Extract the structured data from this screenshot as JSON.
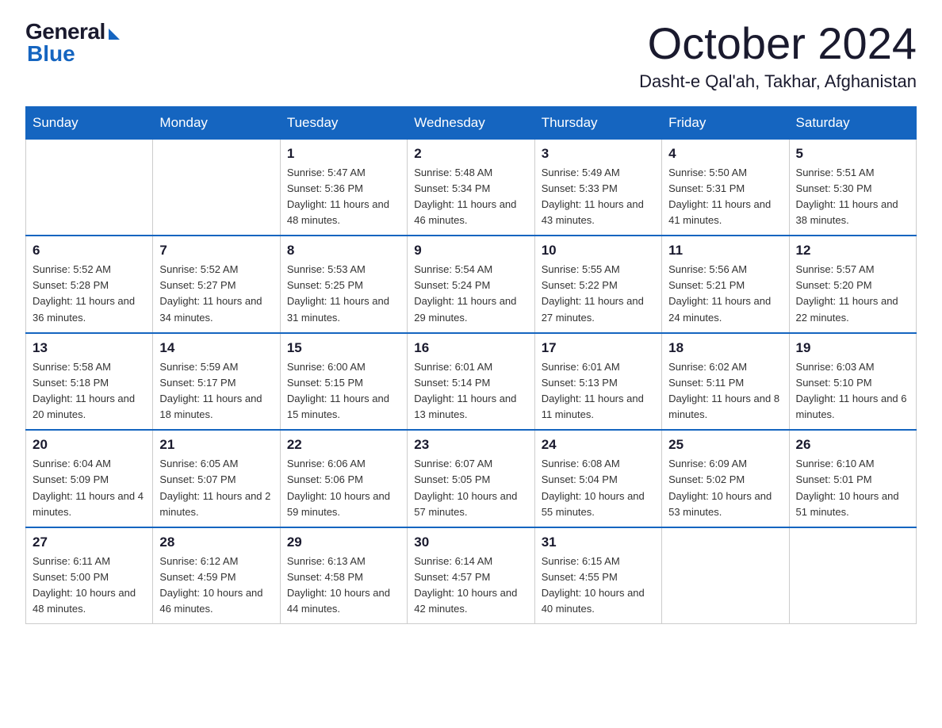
{
  "header": {
    "logo_general": "General",
    "logo_blue": "Blue",
    "month_title": "October 2024",
    "location": "Dasht-e Qal'ah, Takhar, Afghanistan"
  },
  "weekdays": [
    "Sunday",
    "Monday",
    "Tuesday",
    "Wednesday",
    "Thursday",
    "Friday",
    "Saturday"
  ],
  "weeks": [
    [
      {
        "day": "",
        "info": ""
      },
      {
        "day": "",
        "info": ""
      },
      {
        "day": "1",
        "info": "Sunrise: 5:47 AM\nSunset: 5:36 PM\nDaylight: 11 hours\nand 48 minutes."
      },
      {
        "day": "2",
        "info": "Sunrise: 5:48 AM\nSunset: 5:34 PM\nDaylight: 11 hours\nand 46 minutes."
      },
      {
        "day": "3",
        "info": "Sunrise: 5:49 AM\nSunset: 5:33 PM\nDaylight: 11 hours\nand 43 minutes."
      },
      {
        "day": "4",
        "info": "Sunrise: 5:50 AM\nSunset: 5:31 PM\nDaylight: 11 hours\nand 41 minutes."
      },
      {
        "day": "5",
        "info": "Sunrise: 5:51 AM\nSunset: 5:30 PM\nDaylight: 11 hours\nand 38 minutes."
      }
    ],
    [
      {
        "day": "6",
        "info": "Sunrise: 5:52 AM\nSunset: 5:28 PM\nDaylight: 11 hours\nand 36 minutes."
      },
      {
        "day": "7",
        "info": "Sunrise: 5:52 AM\nSunset: 5:27 PM\nDaylight: 11 hours\nand 34 minutes."
      },
      {
        "day": "8",
        "info": "Sunrise: 5:53 AM\nSunset: 5:25 PM\nDaylight: 11 hours\nand 31 minutes."
      },
      {
        "day": "9",
        "info": "Sunrise: 5:54 AM\nSunset: 5:24 PM\nDaylight: 11 hours\nand 29 minutes."
      },
      {
        "day": "10",
        "info": "Sunrise: 5:55 AM\nSunset: 5:22 PM\nDaylight: 11 hours\nand 27 minutes."
      },
      {
        "day": "11",
        "info": "Sunrise: 5:56 AM\nSunset: 5:21 PM\nDaylight: 11 hours\nand 24 minutes."
      },
      {
        "day": "12",
        "info": "Sunrise: 5:57 AM\nSunset: 5:20 PM\nDaylight: 11 hours\nand 22 minutes."
      }
    ],
    [
      {
        "day": "13",
        "info": "Sunrise: 5:58 AM\nSunset: 5:18 PM\nDaylight: 11 hours\nand 20 minutes."
      },
      {
        "day": "14",
        "info": "Sunrise: 5:59 AM\nSunset: 5:17 PM\nDaylight: 11 hours\nand 18 minutes."
      },
      {
        "day": "15",
        "info": "Sunrise: 6:00 AM\nSunset: 5:15 PM\nDaylight: 11 hours\nand 15 minutes."
      },
      {
        "day": "16",
        "info": "Sunrise: 6:01 AM\nSunset: 5:14 PM\nDaylight: 11 hours\nand 13 minutes."
      },
      {
        "day": "17",
        "info": "Sunrise: 6:01 AM\nSunset: 5:13 PM\nDaylight: 11 hours\nand 11 minutes."
      },
      {
        "day": "18",
        "info": "Sunrise: 6:02 AM\nSunset: 5:11 PM\nDaylight: 11 hours\nand 8 minutes."
      },
      {
        "day": "19",
        "info": "Sunrise: 6:03 AM\nSunset: 5:10 PM\nDaylight: 11 hours\nand 6 minutes."
      }
    ],
    [
      {
        "day": "20",
        "info": "Sunrise: 6:04 AM\nSunset: 5:09 PM\nDaylight: 11 hours\nand 4 minutes."
      },
      {
        "day": "21",
        "info": "Sunrise: 6:05 AM\nSunset: 5:07 PM\nDaylight: 11 hours\nand 2 minutes."
      },
      {
        "day": "22",
        "info": "Sunrise: 6:06 AM\nSunset: 5:06 PM\nDaylight: 10 hours\nand 59 minutes."
      },
      {
        "day": "23",
        "info": "Sunrise: 6:07 AM\nSunset: 5:05 PM\nDaylight: 10 hours\nand 57 minutes."
      },
      {
        "day": "24",
        "info": "Sunrise: 6:08 AM\nSunset: 5:04 PM\nDaylight: 10 hours\nand 55 minutes."
      },
      {
        "day": "25",
        "info": "Sunrise: 6:09 AM\nSunset: 5:02 PM\nDaylight: 10 hours\nand 53 minutes."
      },
      {
        "day": "26",
        "info": "Sunrise: 6:10 AM\nSunset: 5:01 PM\nDaylight: 10 hours\nand 51 minutes."
      }
    ],
    [
      {
        "day": "27",
        "info": "Sunrise: 6:11 AM\nSunset: 5:00 PM\nDaylight: 10 hours\nand 48 minutes."
      },
      {
        "day": "28",
        "info": "Sunrise: 6:12 AM\nSunset: 4:59 PM\nDaylight: 10 hours\nand 46 minutes."
      },
      {
        "day": "29",
        "info": "Sunrise: 6:13 AM\nSunset: 4:58 PM\nDaylight: 10 hours\nand 44 minutes."
      },
      {
        "day": "30",
        "info": "Sunrise: 6:14 AM\nSunset: 4:57 PM\nDaylight: 10 hours\nand 42 minutes."
      },
      {
        "day": "31",
        "info": "Sunrise: 6:15 AM\nSunset: 4:55 PM\nDaylight: 10 hours\nand 40 minutes."
      },
      {
        "day": "",
        "info": ""
      },
      {
        "day": "",
        "info": ""
      }
    ]
  ]
}
